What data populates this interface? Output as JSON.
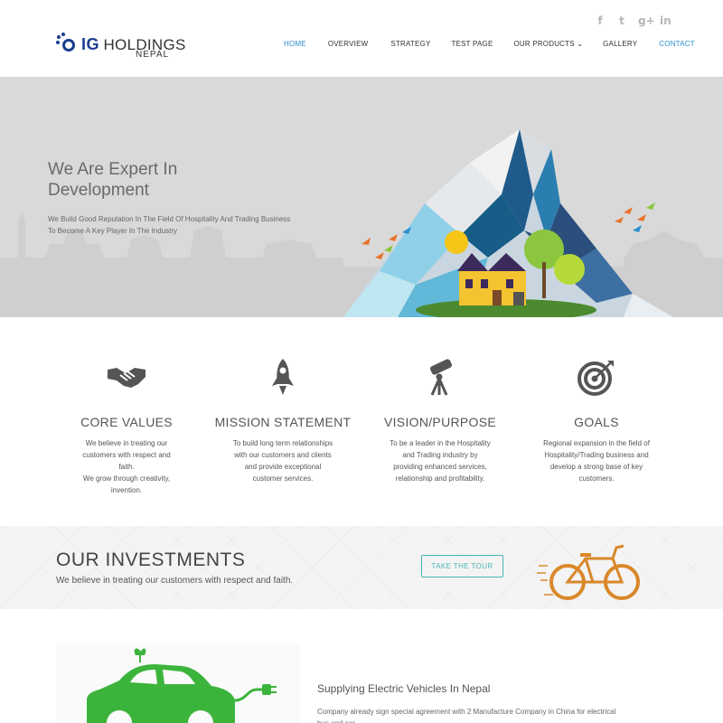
{
  "brand": {
    "mark": "IG",
    "name": "HOLDINGS",
    "sub": "NEPAL"
  },
  "social": [
    {
      "icon": "facebook-icon",
      "glyph": "f"
    },
    {
      "icon": "twitter-icon",
      "glyph": "t"
    },
    {
      "icon": "google-plus-icon",
      "glyph": "g+"
    },
    {
      "icon": "linkedin-icon",
      "glyph": "in"
    }
  ],
  "nav": {
    "items": [
      {
        "label": "HOME"
      },
      {
        "label": "OVERVIEW"
      },
      {
        "label": "STRATEGY"
      },
      {
        "label": "TEST PAGE"
      },
      {
        "label": "OUR PRODUCTS"
      },
      {
        "label": "GALLERY"
      },
      {
        "label": "CONTACT"
      }
    ],
    "dropdown_glyph": "⌄"
  },
  "hero": {
    "title_line1": "We Are Expert In",
    "title_line2": "Development",
    "sub_line1": "We Build Good Reputation In The Field Of Hospitality And Trading Business",
    "sub_line2": "To Become A Key Player In The Industry"
  },
  "features": [
    {
      "icon": "handshake-icon",
      "title": "CORE VALUES",
      "lines": [
        "We believe in treating our",
        "customers with respect and faith.",
        "We grow through creativity,",
        "invention."
      ]
    },
    {
      "icon": "rocket-icon",
      "title": "MISSION STATEMENT",
      "lines": [
        "To build long term relationships",
        "with our customers and clients",
        "and provide exceptional",
        "customer services."
      ]
    },
    {
      "icon": "telescope-icon",
      "title": "VISION/PURPOSE",
      "lines": [
        "To be a leader in the Hospitality",
        "and Trading industry by",
        "providing enhanced services,",
        "relationship and profitability."
      ]
    },
    {
      "icon": "target-icon",
      "title": "GOALS",
      "lines": [
        "Regional expansion in the field of",
        "Hospitality/Trading business and",
        "develop a strong base of key",
        "customers."
      ]
    }
  ],
  "investments": {
    "title": "OUR INVESTMENTS",
    "sub": "We believe in treating our customers with respect and faith.",
    "button": "TAKE THE TOUR"
  },
  "vehicle": {
    "title": "Supplying Electric Vehicles In Nepal",
    "desc": "Company already sign special agreement with 2 Manufacture Company in China for electrical bus and car."
  },
  "colors": {
    "accent": "#2a8fd0",
    "brand": "#1a3d8f",
    "teal": "#46b5b3",
    "green": "#3cb43c"
  }
}
